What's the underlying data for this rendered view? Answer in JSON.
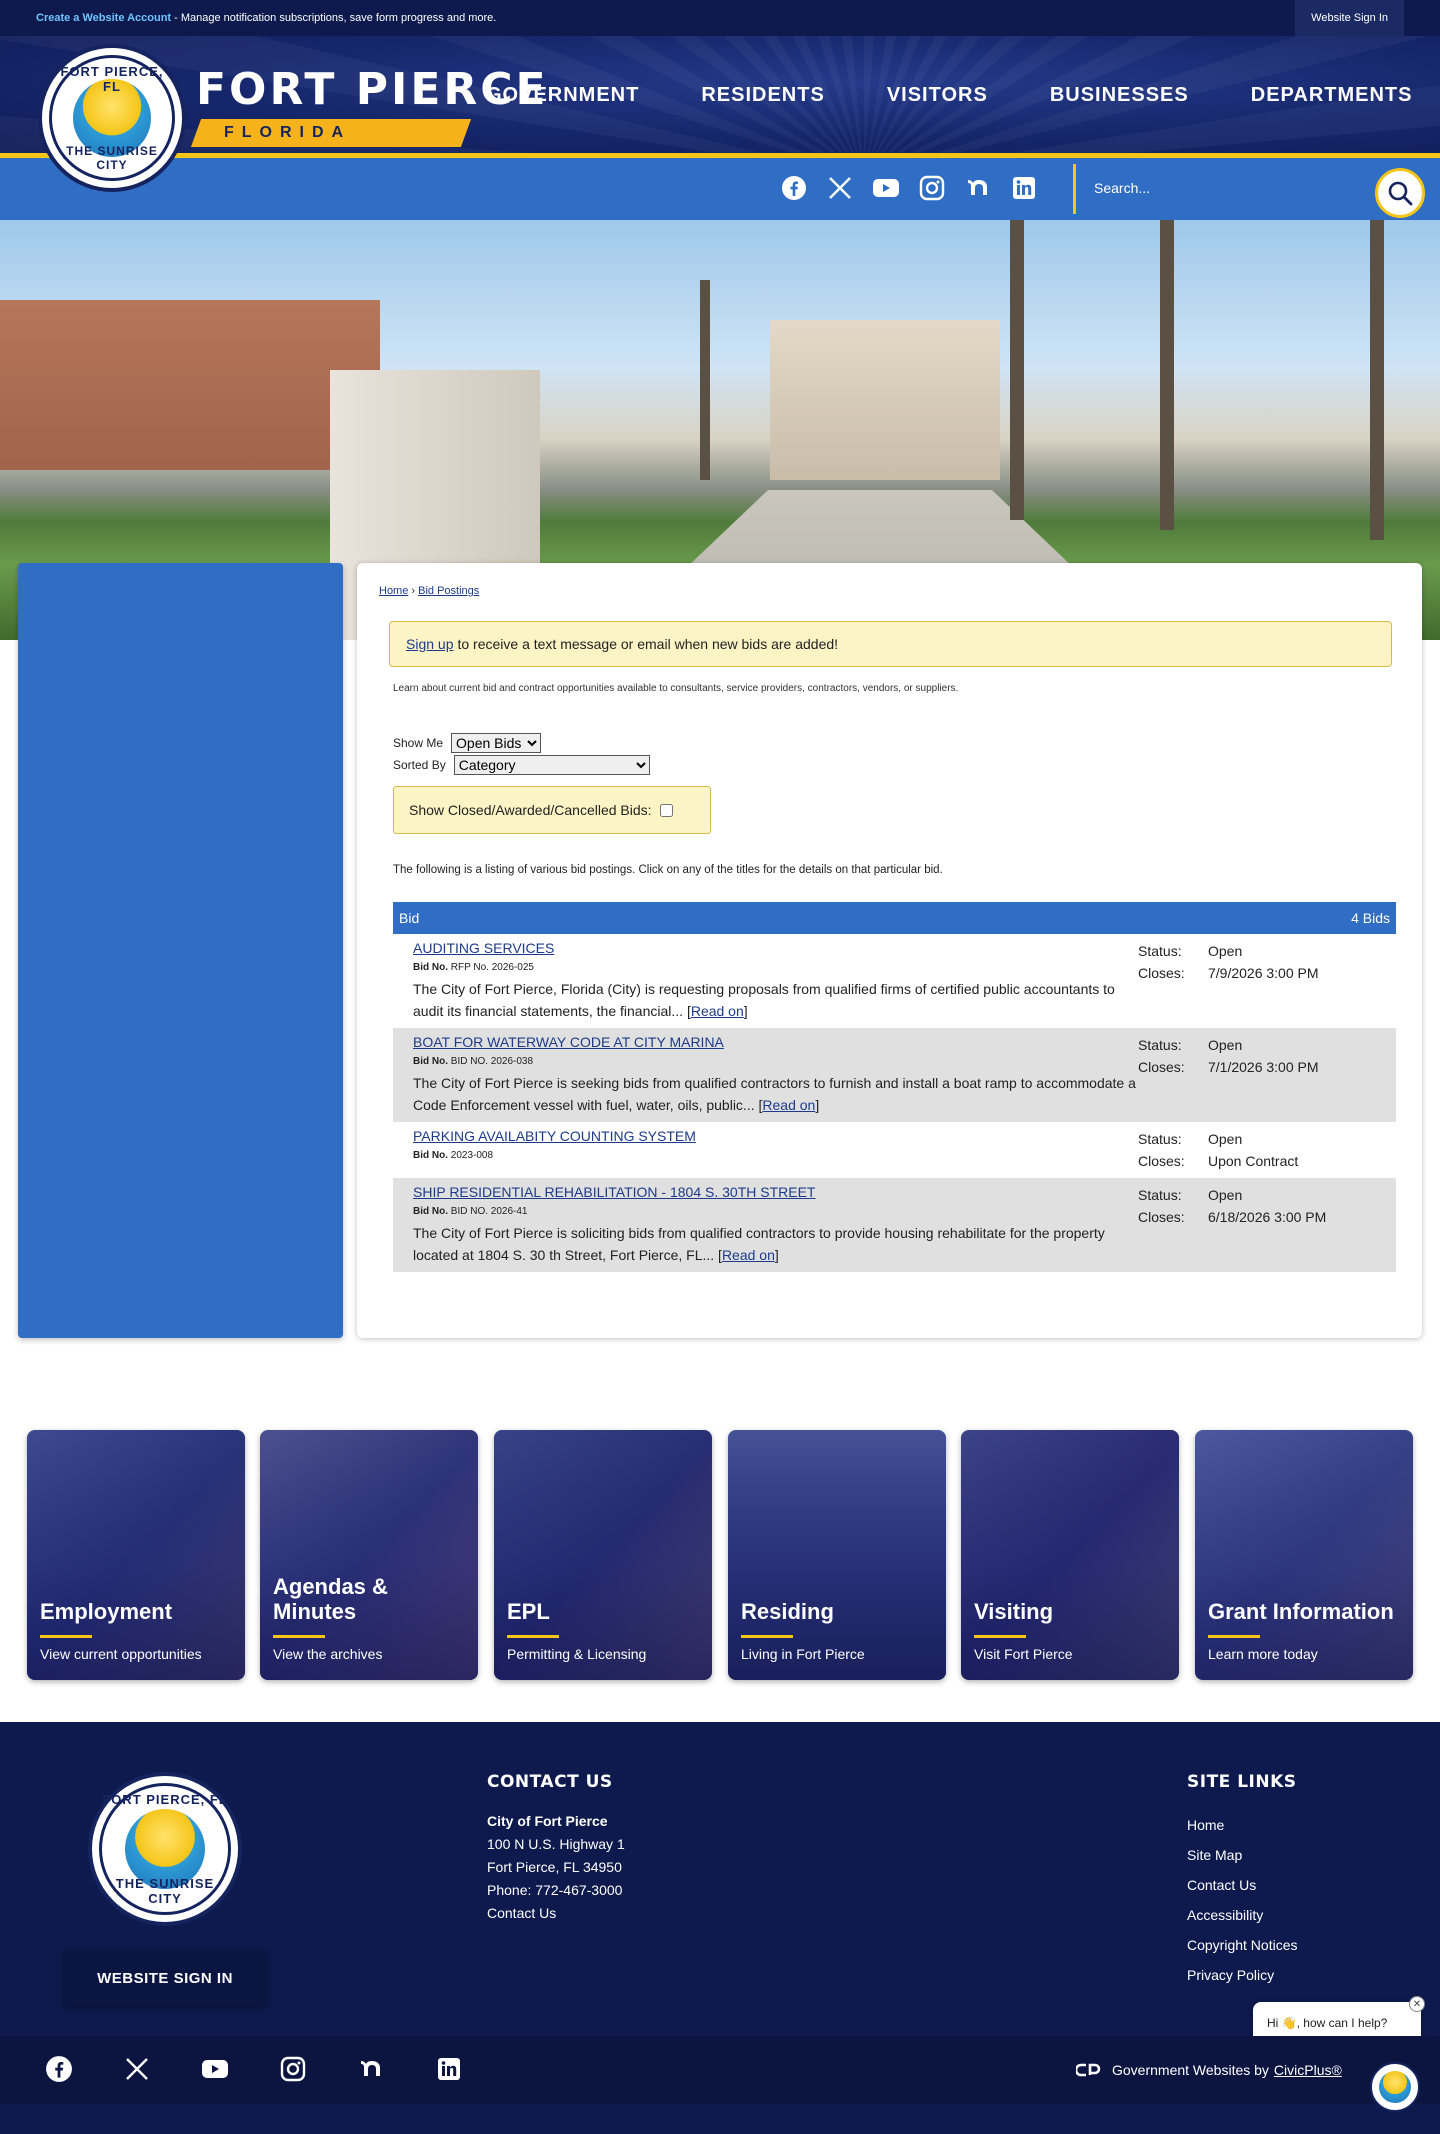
{
  "topbar": {
    "account_link": "Create a Website Account",
    "account_text": " - Manage notification subscriptions, save form progress and more.",
    "signin": "Website Sign In"
  },
  "header": {
    "seal_top": "FORT PIERCE, FL",
    "seal_bottom": "THE SUNRISE CITY",
    "city": "FORT PIERCE",
    "state": "FLORIDA",
    "nav": [
      "GOVERNMENT",
      "RESIDENTS",
      "VISITORS",
      "BUSINESSES",
      "DEPARTMENTS"
    ]
  },
  "search": {
    "placeholder": "Search..."
  },
  "social_icons": [
    "facebook-icon",
    "x-icon",
    "youtube-icon",
    "instagram-icon",
    "nextdoor-icon",
    "linkedin-icon"
  ],
  "colors": {
    "navy": "#0e1a4d",
    "blue": "#2f6ec4",
    "gold": "#f5c518",
    "notice": "#fdf4c6"
  },
  "main": {
    "breadcrumb": {
      "home": "Home",
      "sep": " › ",
      "current": "Bid Postings"
    },
    "notice_link": "Sign up",
    "notice_text": "to receive a text message or email when new bids are added!",
    "learn": "Learn about current bid and contract opportunities available to consultants, service providers, contractors, vendors, or suppliers.",
    "show_me_label": "Show Me",
    "show_me_value": "Open Bids",
    "sorted_by_label": "Sorted By",
    "sorted_by_value": "Category",
    "closed_label": "Show Closed/Awarded/Cancelled Bids:",
    "listing_note": "The following is a listing of various bid postings. Click on any of the titles for the details on that particular bid.",
    "table_head": "Bid",
    "table_count": "4 Bids",
    "bid_no_label": "Bid No.",
    "status_label": "Status:",
    "closes_label": "Closes:",
    "read_on": "Read on",
    "bids": [
      {
        "title": "AUDITING SERVICES",
        "bid_no": "RFP No. 2026-025",
        "desc": "The City of Fort Pierce, Florida (City) is requesting proposals from qualified firms of certified public accountants to audit its financial statements, the financial... ",
        "status": "Open",
        "closes": "7/9/2026 3:00 PM"
      },
      {
        "title": "BOAT FOR WATERWAY CODE AT CITY MARINA",
        "bid_no": "BID NO. 2026-038",
        "desc": "The City of Fort Pierce is seeking bids from qualified contractors to furnish and install a boat ramp to accommodate a Code Enforcement vessel with fuel, water, oils, public... ",
        "status": "Open",
        "closes": "7/1/2026 3:00 PM"
      },
      {
        "title": "PARKING AVAILABITY COUNTING SYSTEM",
        "bid_no": "2023-008",
        "desc": "",
        "status": "Open",
        "closes": "Upon Contract"
      },
      {
        "title": "SHIP RESIDENTIAL REHABILITATION - 1804 S. 30TH STREET",
        "bid_no": "BID NO. 2026-41",
        "desc": "The City of Fort Pierce is soliciting bids from qualified contractors to provide housing rehabilitate for the property located at 1804 S. 30 th Street, Fort Pierce, FL... ",
        "status": "Open",
        "closes": "6/18/2026 3:00 PM"
      }
    ]
  },
  "tiles": [
    {
      "title": "Employment",
      "sub": "View current opportunities"
    },
    {
      "title": "Agendas & Minutes",
      "sub": "View the archives"
    },
    {
      "title": "EPL",
      "sub": "Permitting & Licensing"
    },
    {
      "title": "Residing",
      "sub": "Living in Fort Pierce"
    },
    {
      "title": "Visiting",
      "sub": "Visit Fort Pierce"
    },
    {
      "title": "Grant Information",
      "sub": "Learn more today"
    }
  ],
  "footer": {
    "signin": "WEBSITE SIGN IN",
    "contact_heading": "CONTACT US",
    "contact_name": "City of Fort Pierce",
    "contact_address1": "100 N U.S. Highway 1",
    "contact_address2": "Fort Pierce, FL 34950",
    "contact_phone": "Phone: 772-467-3000",
    "contact_link": "Contact Us",
    "site_heading": "SITE LINKS",
    "site_links": [
      "Home",
      "Site Map",
      "Contact Us",
      "Accessibility",
      "Copyright Notices",
      "Privacy Policy"
    ],
    "credit_text": "Government Websites by",
    "credit_link": "CivicPlus®",
    "chat": "Hi 👋, how can I help?",
    "chat_close": "✕"
  }
}
